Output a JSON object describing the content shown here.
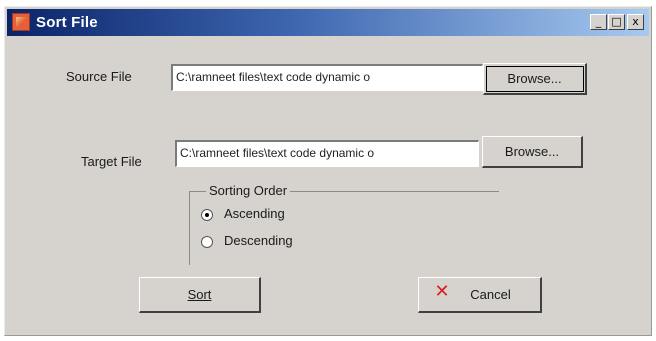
{
  "window": {
    "title": "Sort File",
    "minimize": "_",
    "maximize": "□",
    "close": "x"
  },
  "source": {
    "label": "Source File",
    "value": "C:\\ramneet files\\text code dynamic o",
    "browse_label": "Browse..."
  },
  "target": {
    "label": "Target File",
    "value": "C:\\ramneet files\\text code dynamic o",
    "browse_label": "Browse..."
  },
  "sorting": {
    "group_label": "Sorting Order",
    "options": [
      {
        "label": "Ascending",
        "selected": true
      },
      {
        "label": "Descending",
        "selected": false
      }
    ]
  },
  "actions": {
    "sort_label": "Sort",
    "cancel_label": "Cancel",
    "cancel_icon": "x-icon"
  }
}
